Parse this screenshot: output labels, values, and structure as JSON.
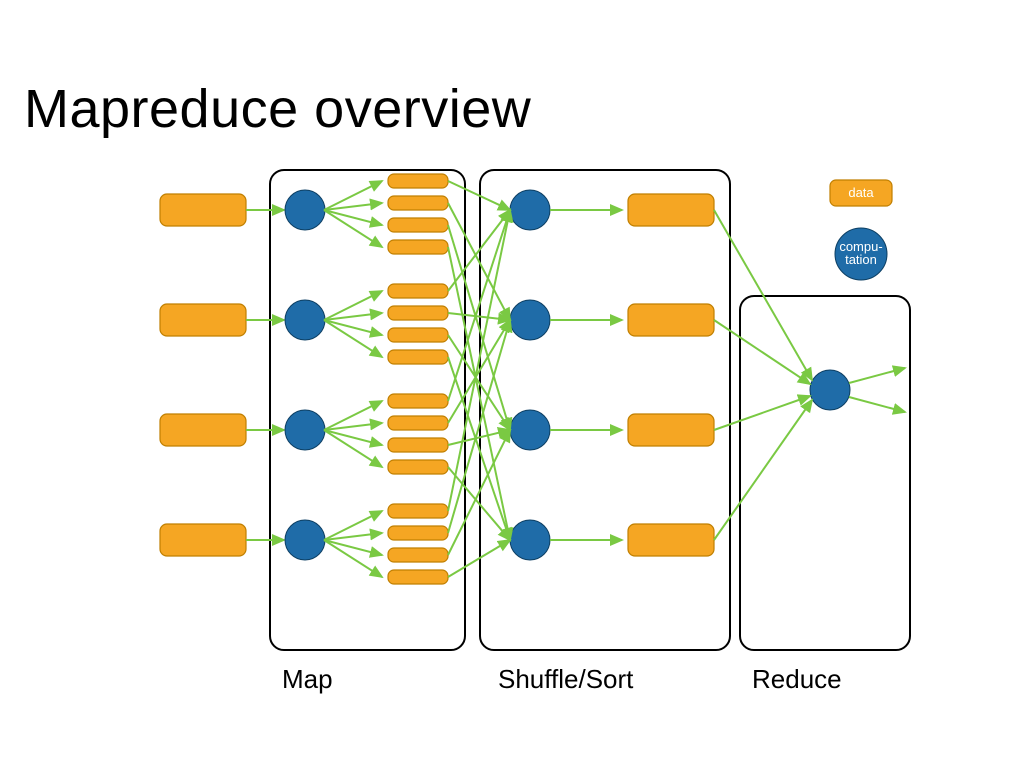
{
  "title": "Mapreduce overview",
  "stages": {
    "map": "Map",
    "shuffle": "Shuffle/Sort",
    "reduce": "Reduce"
  },
  "legend": {
    "data": "data",
    "computation_line1": "compu-",
    "computation_line2": "tation"
  },
  "diagram": {
    "input_blocks": 4,
    "mappers": 4,
    "map_outputs_per_mapper": 4,
    "reducers_stage2": 4,
    "reduce_inputs": 4,
    "final_reducers": 1,
    "final_outputs": 2
  }
}
